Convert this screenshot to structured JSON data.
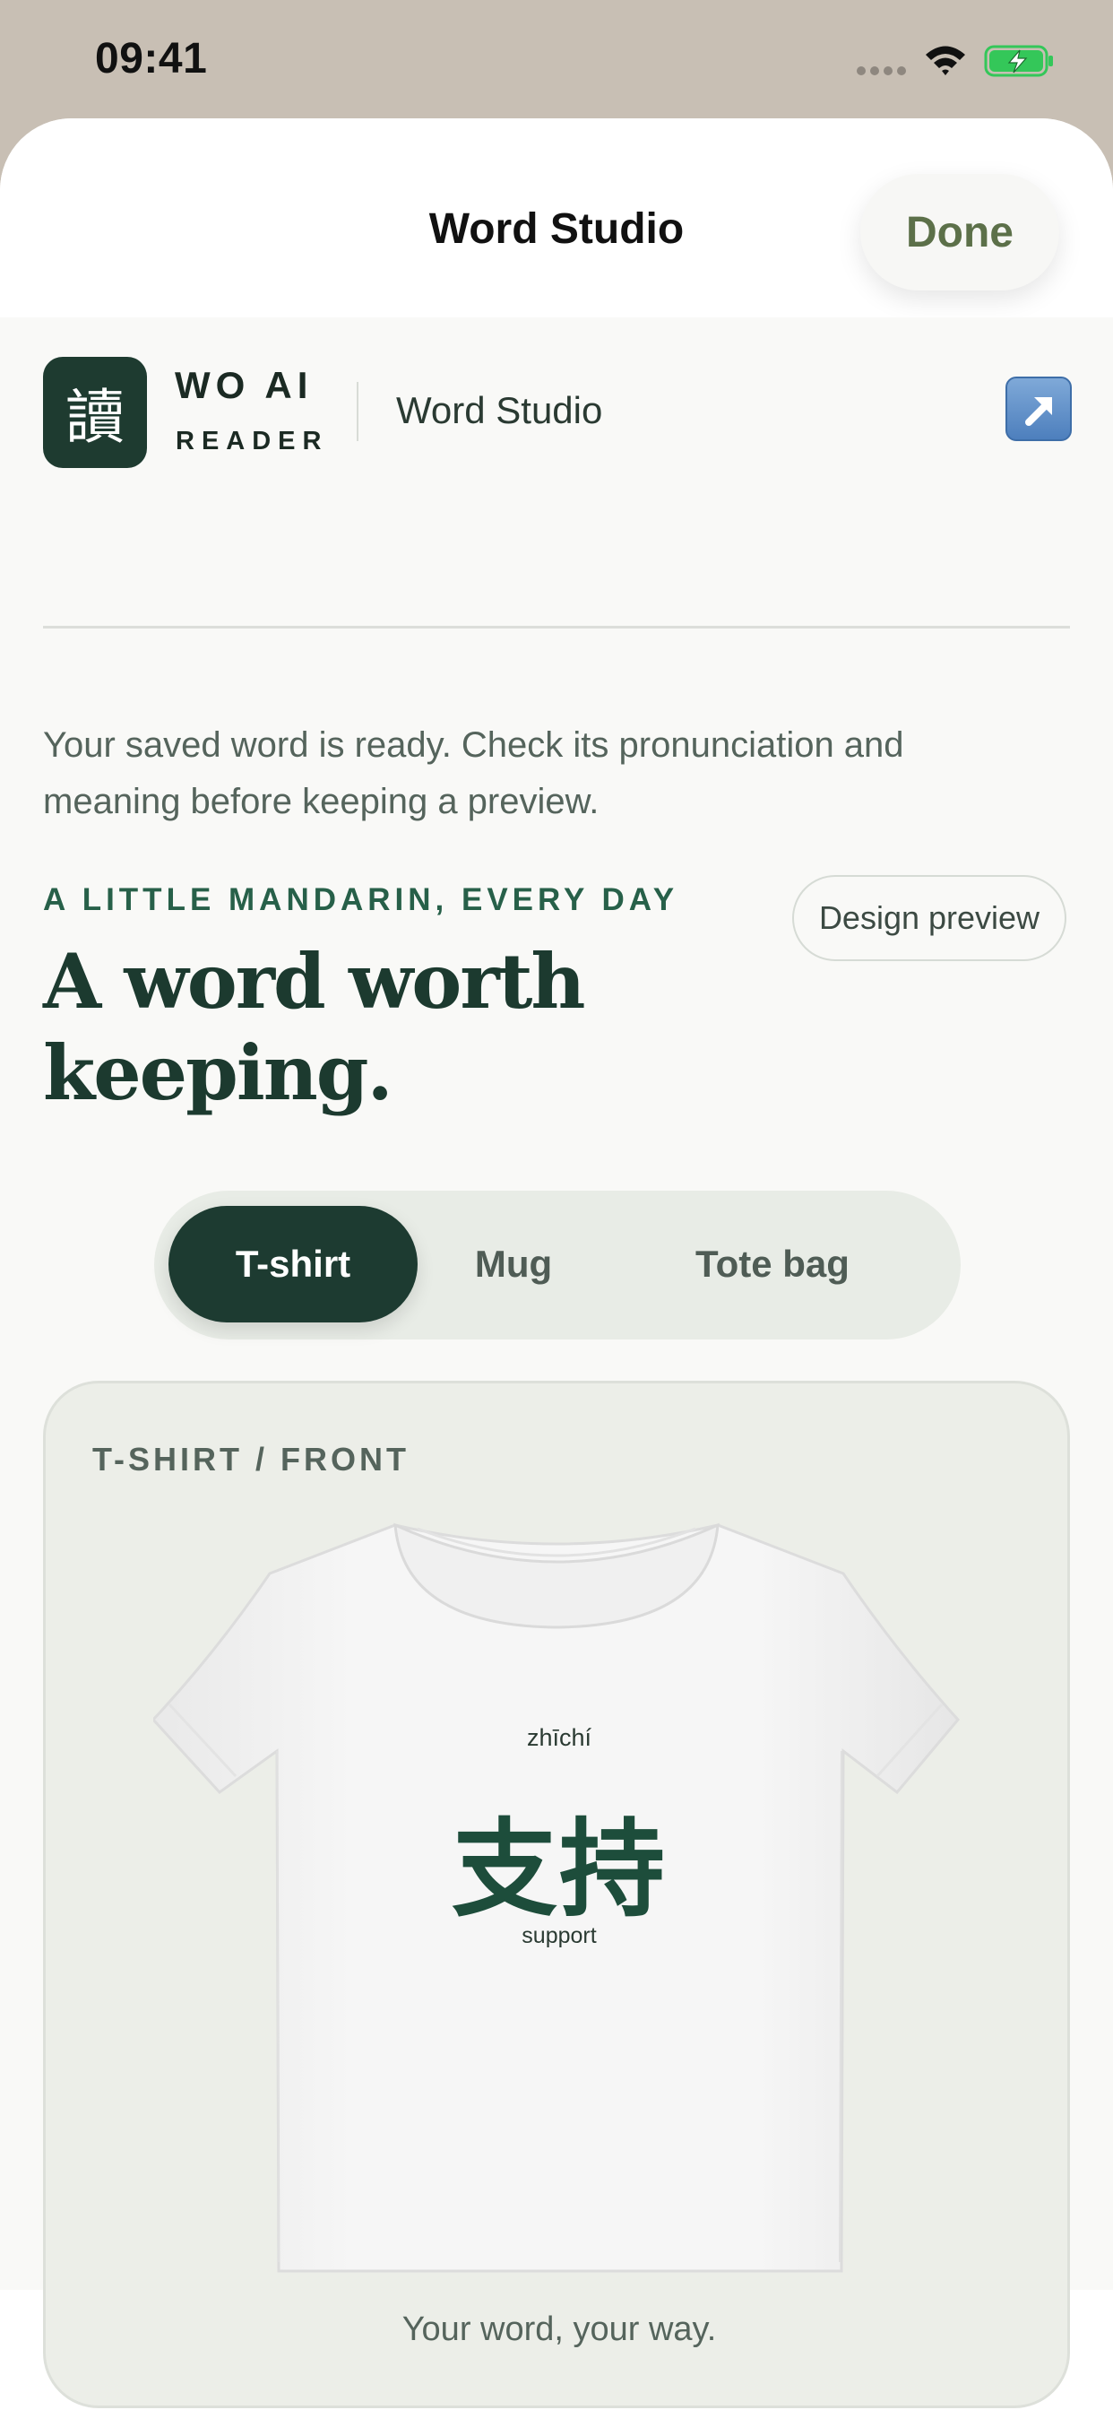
{
  "status_bar": {
    "time": "09:41",
    "icons": [
      "signal-dots-icon",
      "wifi-icon",
      "battery-charging-icon"
    ]
  },
  "sheet": {
    "title": "Word Studio",
    "done_label": "Done"
  },
  "brand": {
    "logo_glyph": "讀",
    "name": "WO AI",
    "subtitle": "READER",
    "section": "Word Studio",
    "external_icon": "external-link-icon"
  },
  "intro": "Your saved word is ready. Check its pronunciation and meaning before keeping a preview.",
  "kicker": "A LITTLE MANDARIN, EVERY DAY",
  "design_preview_label": "Design preview",
  "headline": "A word worth keeping.",
  "product_tabs": [
    {
      "label": "T-shirt",
      "selected": true
    },
    {
      "label": "Mug",
      "selected": false
    },
    {
      "label": "Tote bag",
      "selected": false
    }
  ],
  "preview": {
    "label": "T-SHIRT / FRONT",
    "pinyin": "zhīchí",
    "hanzi": "支持",
    "meaning": "support",
    "caption": "Your word, your way."
  },
  "colors": {
    "brand_dark_green": "#1d3b31",
    "accent_green": "#276049",
    "done_text": "#5c7049",
    "print_green": "#1d4d3b"
  }
}
